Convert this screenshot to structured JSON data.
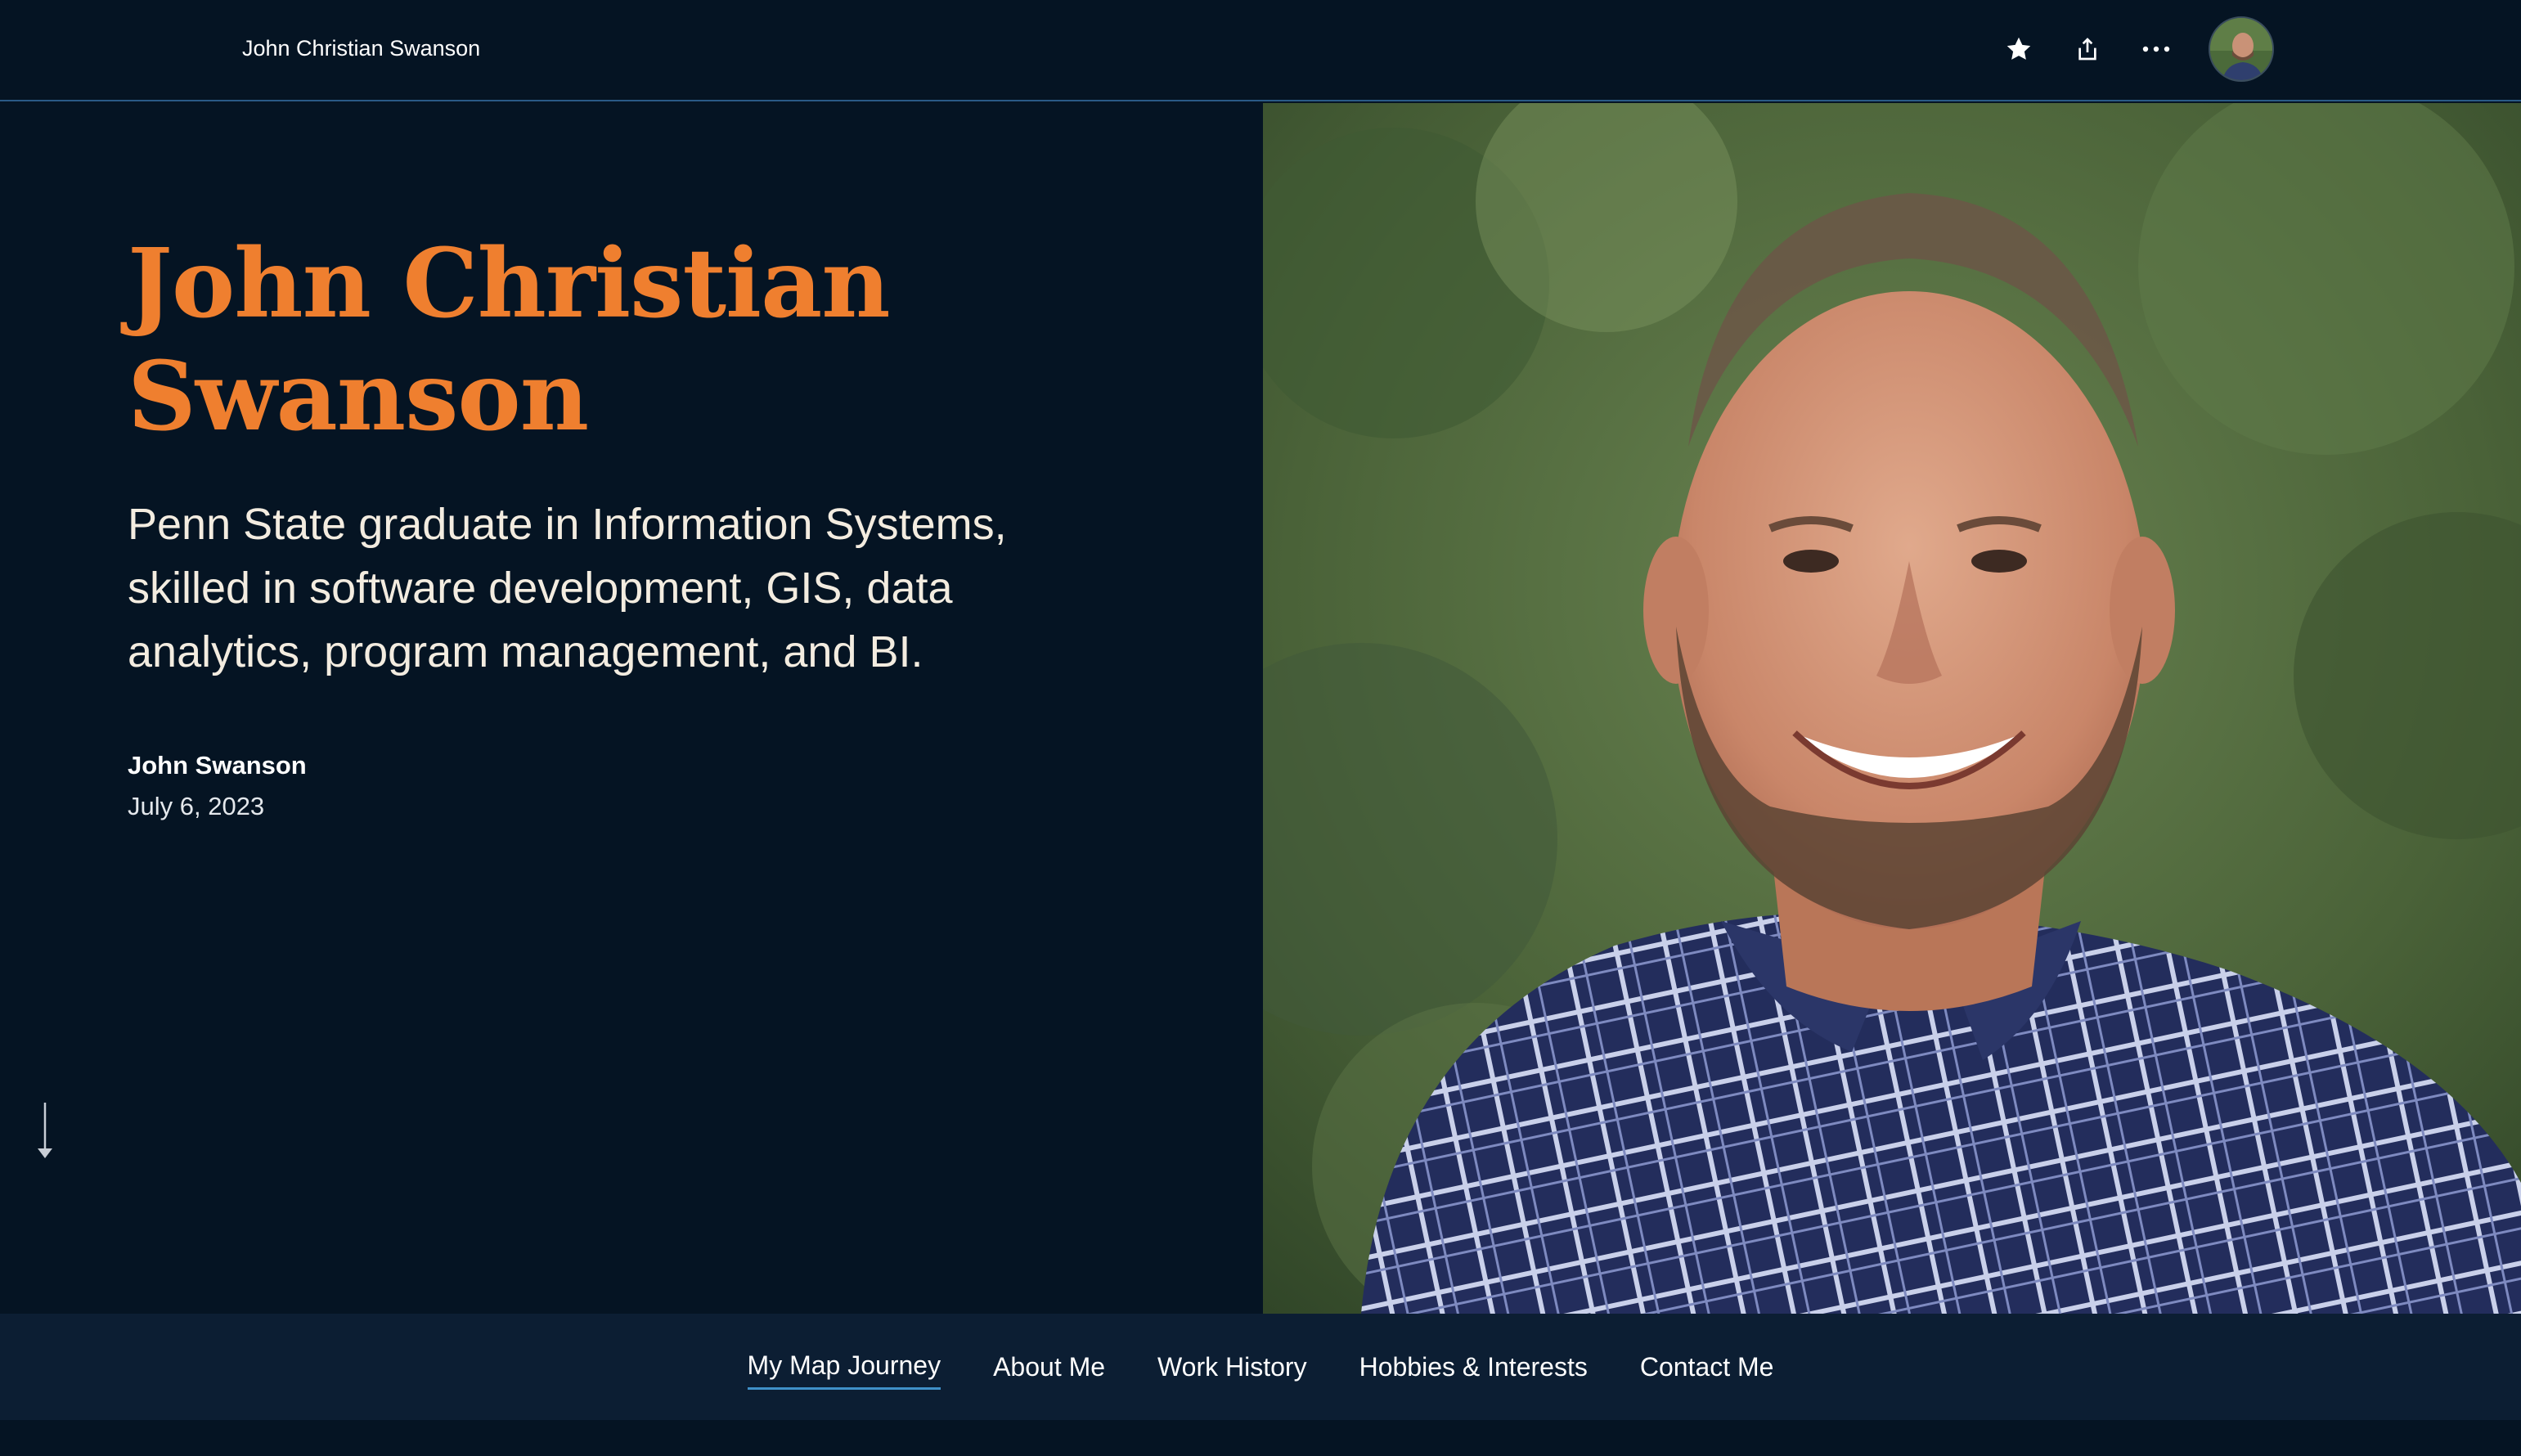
{
  "header": {
    "site_title": "John Christian Swanson",
    "icons": [
      "star-icon",
      "share-icon",
      "more-options-icon"
    ],
    "avatar": "user-avatar"
  },
  "hero": {
    "title_line1": "John Christian",
    "title_line2": "Swanson",
    "subtitle": "Penn State graduate in Information Systems, skilled in software development, GIS, data analytics, program management, and BI.",
    "author": "John Swanson",
    "date": "July 6, 2023",
    "title_color": "#ef7f2f",
    "background_color": "#051423"
  },
  "nav": {
    "items": [
      {
        "label": "My Map Journey",
        "active": true
      },
      {
        "label": "About Me",
        "active": false
      },
      {
        "label": "Work History",
        "active": false
      },
      {
        "label": "Hobbies & Interests",
        "active": false
      },
      {
        "label": "Contact Me",
        "active": false
      }
    ],
    "accent_color": "#3f90c8"
  }
}
